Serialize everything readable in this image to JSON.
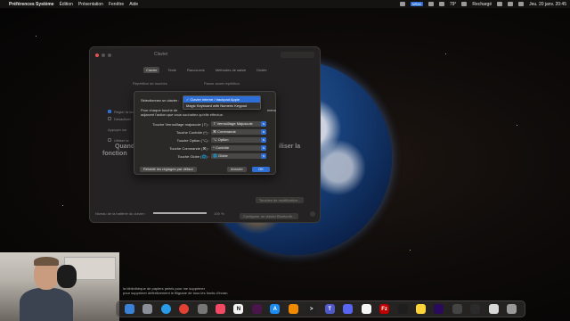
{
  "menubar": {
    "apple_icon": "apple-icon",
    "app_name": "Préférences Système",
    "menus": [
      "Édition",
      "Présentation",
      "Fenêtre",
      "Aide"
    ],
    "weather": "79°",
    "battery_label": "Rechargé",
    "badge": "NRIM",
    "clock": "Jeu. 20 janv. 20:45"
  },
  "window": {
    "title": "Clavier",
    "tabs": [
      "Clavier",
      "Texte",
      "Raccourcis",
      "Méthodes de saisie",
      "Dictée"
    ],
    "active_tab": 0,
    "key_repeat_label": "Répétition de touches",
    "delay_label": "Pause avant répétition",
    "check_1": "Régler la lum",
    "check_2": "Désactiver",
    "press_label": "Appuyer sur",
    "check_3": "Utiliser la",
    "big_text_1": "Quand",
    "big_text_2": "fonction",
    "big_text_right": "iliser la",
    "modifier_button": "Touches de modification...",
    "bluetooth_button": "Configurer un clavier Bluetooth...",
    "battery_label": "Niveau de la batterie du clavier :",
    "battery_value": "100 %",
    "battery_level": 1.0
  },
  "sheet": {
    "select_keyboard_label": "Sélectionnez un clavier :",
    "description_line1": "Pour chaque touche de",
    "description_line2": "adjacent l'action que vous souhaitez qu'elle effectue.",
    "description_right": "menu",
    "rows": [
      {
        "label": "Touche Verrouillage majuscule (⇪) :",
        "value": "⇪ Verrouillage Majuscule"
      },
      {
        "label": "Touche Contrôle (^) :",
        "value": "⌘ Commande"
      },
      {
        "label": "Touche Option (⌥) :",
        "value": "⌥ Option"
      },
      {
        "label": "Touche Commande (⌘) :",
        "value": "^ Contrôle"
      },
      {
        "label": "Touche Globe (🌐) :",
        "value": "🌐 Globe"
      }
    ],
    "reset_button": "Rétablir les réglages par défaut",
    "cancel_button": "Annuler",
    "ok_button": "OK",
    "accent_color": "#2d6fd6"
  },
  "popup": {
    "items": [
      "✓ Clavier interne / trackpad Apple",
      "Magic Keyboard with Numeric Keypad"
    ],
    "selected_index": 0
  },
  "notification": {
    "line1": "la bibliothèque de papiers peints pour me supprimer",
    "line2": "pour supprimer définitivement le filigrane de tous les fonds d'écran"
  },
  "dock": {
    "icons": [
      "finder-icon",
      "launchpad-icon",
      "safari-icon",
      "chrome-icon",
      "system-preferences-icon",
      "music-icon",
      "notion-icon",
      "slack-icon",
      "app-store-icon",
      "vlc-icon",
      "terminal-icon",
      "teams-icon",
      "discord-icon",
      "photos-icon",
      "filezilla-icon",
      "figma-icon",
      "notes-icon",
      "premiere-icon",
      "capture-icon",
      "video-icon",
      "folder-icon",
      "trash-icon"
    ]
  }
}
